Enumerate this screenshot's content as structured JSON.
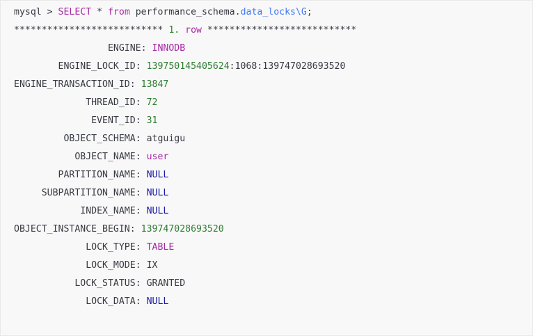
{
  "command": {
    "prompt": "mysql > ",
    "kw_select": "SELECT",
    "star": " * ",
    "kw_from": "from",
    "schema": " performance_schema.",
    "table": "data_locks\\G",
    "end": ";"
  },
  "row_header": {
    "stars_left": "*************************** ",
    "num": "1.",
    "space": " ",
    "word": "row",
    "stars_right": " ***************************"
  },
  "rows": [
    {
      "pad": "                 ",
      "key": "ENGINE",
      "value": "INNODB",
      "kind": "keyword"
    },
    {
      "pad": "        ",
      "key": "ENGINE_LOCK_ID",
      "value": "139750145405624",
      "extra": ":1068:139747028693520",
      "kind": "number"
    },
    {
      "pad": "",
      "key": "ENGINE_TRANSACTION_ID",
      "value": "13847",
      "kind": "number"
    },
    {
      "pad": "             ",
      "key": "THREAD_ID",
      "value": "72",
      "kind": "number"
    },
    {
      "pad": "              ",
      "key": "EVENT_ID",
      "value": "31",
      "kind": "number"
    },
    {
      "pad": "         ",
      "key": "OBJECT_SCHEMA",
      "value": "atguigu",
      "kind": "plain"
    },
    {
      "pad": "           ",
      "key": "OBJECT_NAME",
      "value": "user",
      "kind": "keyword"
    },
    {
      "pad": "        ",
      "key": "PARTITION_NAME",
      "value": "NULL",
      "kind": "null"
    },
    {
      "pad": "     ",
      "key": "SUBPARTITION_NAME",
      "value": "NULL",
      "kind": "null"
    },
    {
      "pad": "            ",
      "key": "INDEX_NAME",
      "value": "NULL",
      "kind": "null"
    },
    {
      "pad": "",
      "key": "OBJECT_INSTANCE_BEGIN",
      "value": "139747028693520",
      "kind": "number"
    },
    {
      "pad": "             ",
      "key": "LOCK_TYPE",
      "value": "TABLE",
      "kind": "keyword"
    },
    {
      "pad": "             ",
      "key": "LOCK_MODE",
      "value": "IX",
      "kind": "plain"
    },
    {
      "pad": "           ",
      "key": "LOCK_STATUS",
      "value": "GRANTED",
      "kind": "plain"
    },
    {
      "pad": "             ",
      "key": "LOCK_DATA",
      "value": "NULL",
      "kind": "null"
    }
  ],
  "separator": ": "
}
